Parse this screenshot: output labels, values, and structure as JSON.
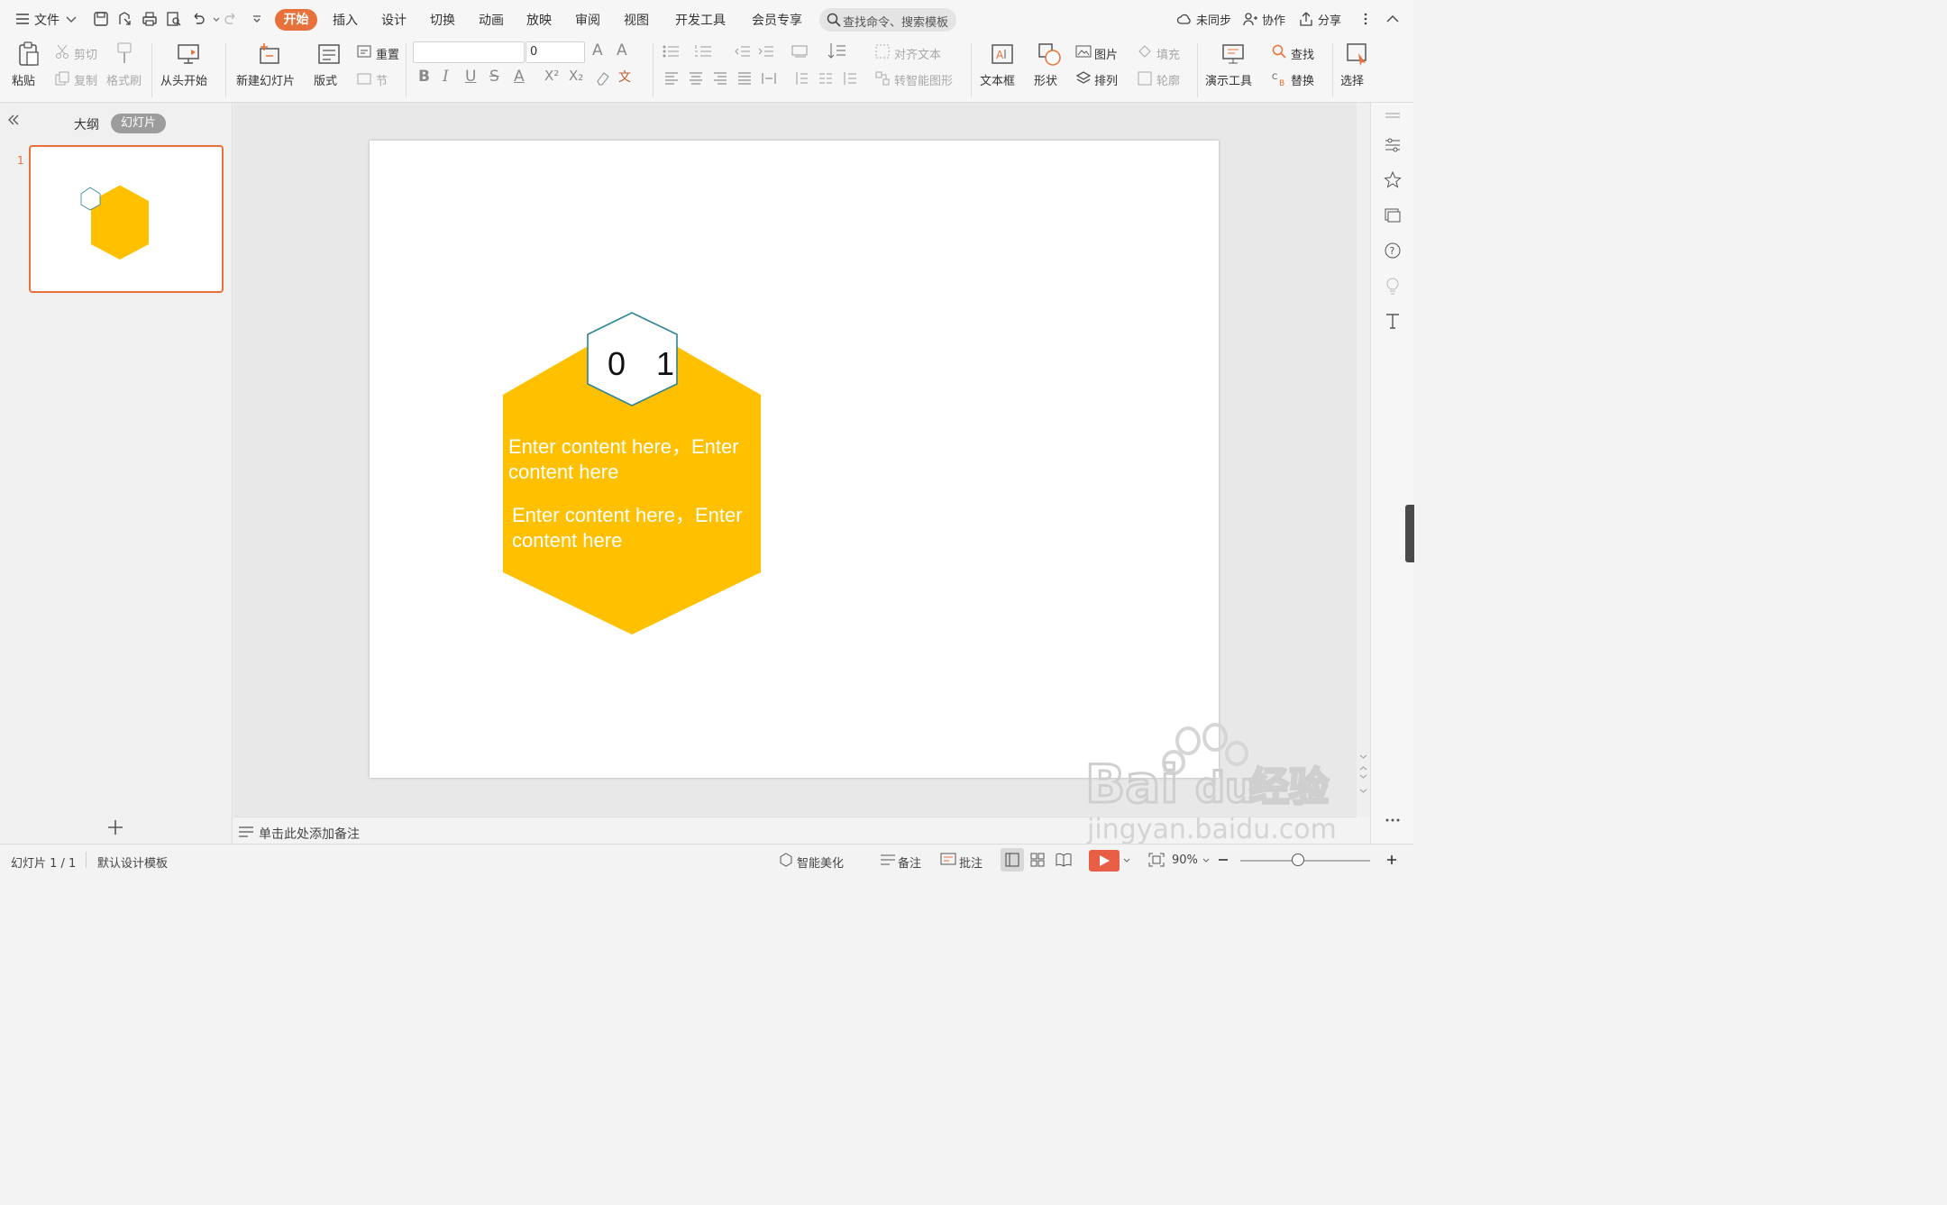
{
  "menubar": {
    "file_label": "文件",
    "tabs": [
      "开始",
      "插入",
      "设计",
      "切换",
      "动画",
      "放映",
      "审阅",
      "视图",
      "开发工具",
      "会员专享"
    ],
    "search_placeholder": "查找命令、搜索模板",
    "sync_label": "未同步",
    "collab_label": "协作",
    "share_label": "分享"
  },
  "ribbon": {
    "paste": "粘贴",
    "cut": "剪切",
    "copy": "复制",
    "format_painter": "格式刷",
    "from_start": "从头开始",
    "new_slide": "新建幻灯片",
    "layout": "版式",
    "reset": "重置",
    "section": "节",
    "font_size": "0",
    "align_text": "对齐文本",
    "smartart": "转智能图形",
    "textbox": "文本框",
    "shape": "形状",
    "picture": "图片",
    "arrange": "排列",
    "fill": "填充",
    "outline": "轮廓",
    "present_tools": "演示工具",
    "find": "查找",
    "replace": "替换",
    "select": "选择"
  },
  "leftpanel": {
    "outline_tab": "大纲",
    "slides_tab": "幻灯片",
    "slide_number": "1"
  },
  "slide": {
    "hex_number": "0 1",
    "text1_line1": "Enter content here，Enter",
    "text1_line2": "content here",
    "text2_line1": "Enter content here，Enter",
    "text2_line2": "content here",
    "colors": {
      "hexagon_fill": "#FFC000",
      "badge_border": "#2E8494"
    }
  },
  "notes": {
    "placeholder": "单击此处添加备注"
  },
  "statusbar": {
    "slide_counter": "幻灯片 1 / 1",
    "template": "默认设计模板",
    "beautify": "智能美化",
    "notes": "备注",
    "comments": "批注",
    "zoom": "90%"
  },
  "watermark": {
    "brand": "Bai du 经验",
    "url": "jingyan.baidu.com"
  },
  "accent_color": "#E8703A"
}
